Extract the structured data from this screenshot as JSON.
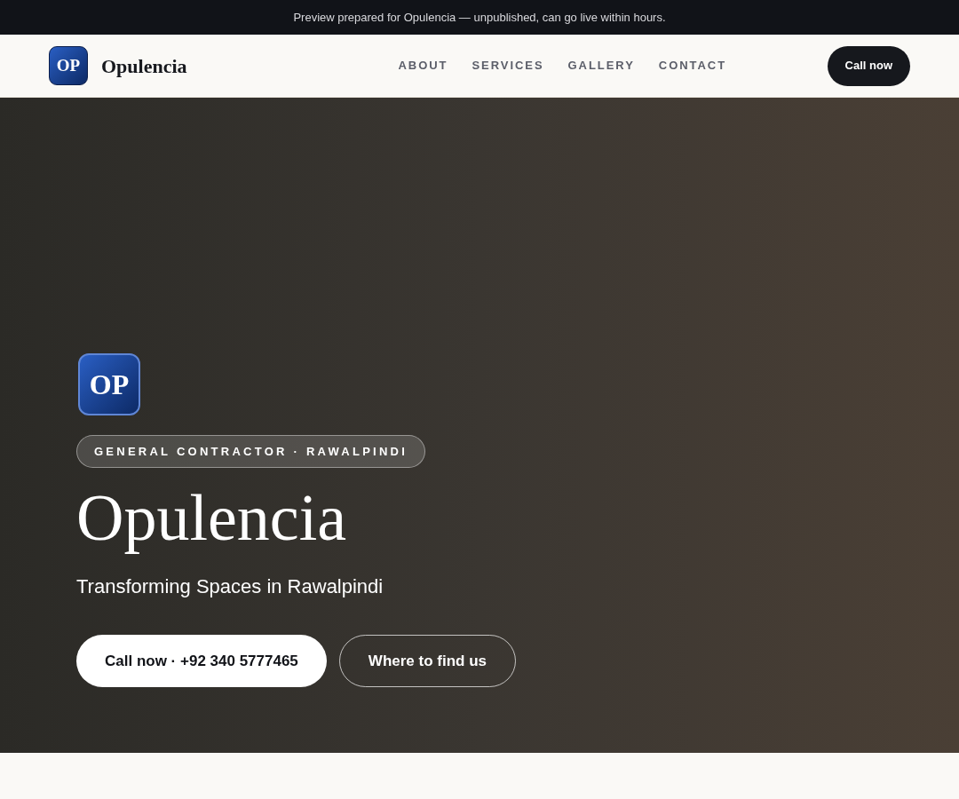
{
  "announcement": "Preview prepared for Opulencia — unpublished, can go live within hours.",
  "header": {
    "logo_initials": "OP",
    "brand": "Opulencia",
    "nav": [
      {
        "label": "ABOUT"
      },
      {
        "label": "SERVICES"
      },
      {
        "label": "GALLERY"
      },
      {
        "label": "CONTACT"
      }
    ],
    "cta": "Call now"
  },
  "hero": {
    "logo_initials": "OP",
    "tagline": "GENERAL CONTRACTOR · RAWALPINDI",
    "title": "Opulencia",
    "subtitle": "Transforming Spaces in Rawalpindi",
    "buttons": [
      {
        "label": "Call now · +92 340 5777465",
        "kind": "primary"
      },
      {
        "label": "Where to find us",
        "kind": "outline"
      }
    ]
  }
}
